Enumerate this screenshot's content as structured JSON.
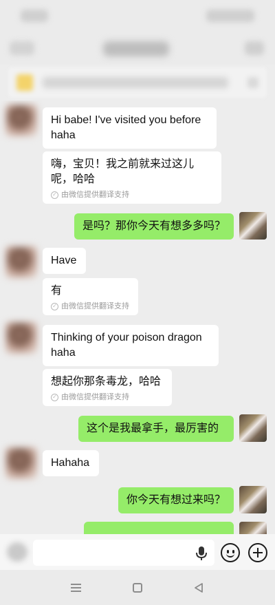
{
  "messages": [
    {
      "type": "incoming",
      "text": "Hi babe! I've visited you before haha"
    },
    {
      "type": "translation",
      "text": "嗨，宝贝！我之前就来过这儿呢，哈哈",
      "meta": "由微信提供翻译支持"
    },
    {
      "type": "outgoing",
      "text": "是吗？那你今天有想多多吗？"
    },
    {
      "type": "incoming",
      "text": "Have"
    },
    {
      "type": "translation",
      "text": "有",
      "meta": "由微信提供翻译支持"
    },
    {
      "type": "incoming",
      "text": "Thinking of your poison dragon haha"
    },
    {
      "type": "translation",
      "text": "想起你那条毒龙，哈哈",
      "meta": "由微信提供翻译支持"
    },
    {
      "type": "outgoing",
      "text": "这个是我最拿手，最厉害的"
    },
    {
      "type": "incoming",
      "text": "Hahaha"
    },
    {
      "type": "outgoing",
      "text": "你今天有想过来吗？"
    }
  ],
  "colors": {
    "outgoing_bubble": "#95ec69",
    "incoming_bubble": "#ffffff",
    "background": "#ededed"
  },
  "icons": {
    "input": [
      "voice-toggle-icon",
      "mic-icon",
      "emoji-icon",
      "plus-icon"
    ],
    "nav": [
      "menu-icon",
      "home-icon",
      "back-icon"
    ]
  }
}
